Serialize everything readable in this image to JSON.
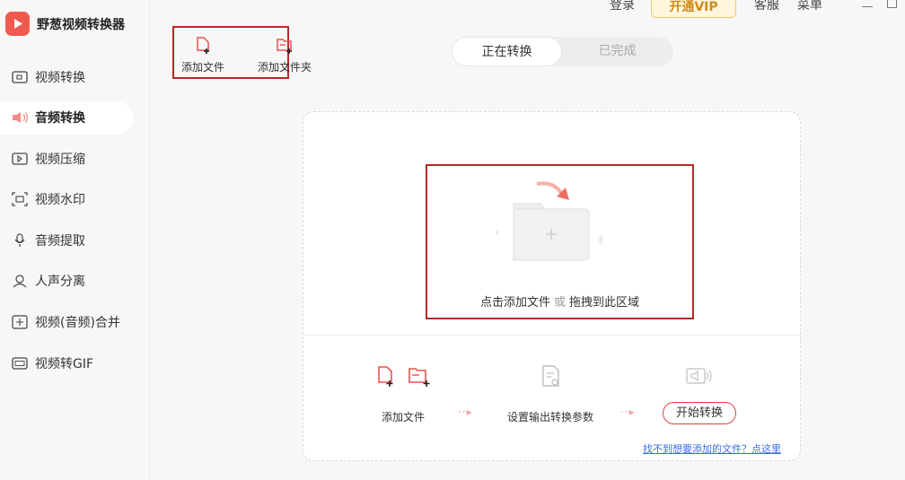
{
  "app": {
    "title": "野葱视频转换器"
  },
  "header": {
    "login": "登录",
    "vip": "开通VIP",
    "service": "客服",
    "menu": "菜单"
  },
  "sidebar": {
    "items": [
      {
        "label": "视频转换",
        "icon": "video-convert-icon"
      },
      {
        "label": "音频转换",
        "icon": "audio-convert-icon",
        "active": true
      },
      {
        "label": "视频压缩",
        "icon": "video-compress-icon"
      },
      {
        "label": "视频水印",
        "icon": "watermark-icon"
      },
      {
        "label": "音频提取",
        "icon": "audio-extract-icon"
      },
      {
        "label": "人声分离",
        "icon": "voice-separate-icon"
      },
      {
        "label": "视频(音频)合并",
        "icon": "merge-icon"
      },
      {
        "label": "视频转GIF",
        "icon": "gif-icon"
      }
    ]
  },
  "toolbar": {
    "add_file": "添加文件",
    "add_folder": "添加文件夹"
  },
  "tabs": {
    "converting": "正在转换",
    "done": "已完成"
  },
  "drop": {
    "text_a": "点击添加文件",
    "or": "或",
    "text_b": "拖拽到此区域"
  },
  "steps": {
    "add": "添加文件",
    "settings": "设置输出转换参数",
    "start": "开始转换",
    "help": "找不到想要添加的文件？点这里"
  },
  "colors": {
    "accent": "#ef5a4f",
    "highlight": "#b52a28"
  }
}
